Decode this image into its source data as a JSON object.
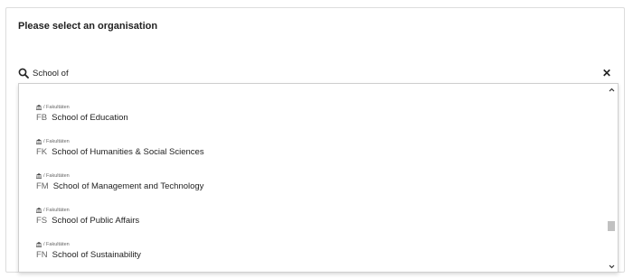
{
  "header": {
    "title": "Please select an organisation"
  },
  "search": {
    "value": "School of",
    "placeholder": ""
  },
  "dropdown": {
    "options": [
      {
        "breadcrumb": "/ Fakultäten",
        "code": "FB",
        "label": "School of Education"
      },
      {
        "breadcrumb": "/ Fakultäten",
        "code": "FK",
        "label": "School of Humanities & Social Sciences"
      },
      {
        "breadcrumb": "/ Fakultäten",
        "code": "FM",
        "label": "School of Management and Technology"
      },
      {
        "breadcrumb": "/ Fakultäten",
        "code": "FS",
        "label": "School of Public Affairs"
      },
      {
        "breadcrumb": "/ Fakultäten",
        "code": "FN",
        "label": "School of Sustainability"
      }
    ],
    "scroll_position": 0.8
  },
  "icons": {
    "search": "search-icon",
    "clear": "close-icon",
    "breadcrumb": "institution-icon",
    "scroll_up": "chevron-up-icon",
    "scroll_down": "chevron-down-icon"
  },
  "colors": {
    "border": "#dcdcdc",
    "text": "#222222",
    "muted": "#666666",
    "scroll_thumb": "#c1c1c1"
  }
}
